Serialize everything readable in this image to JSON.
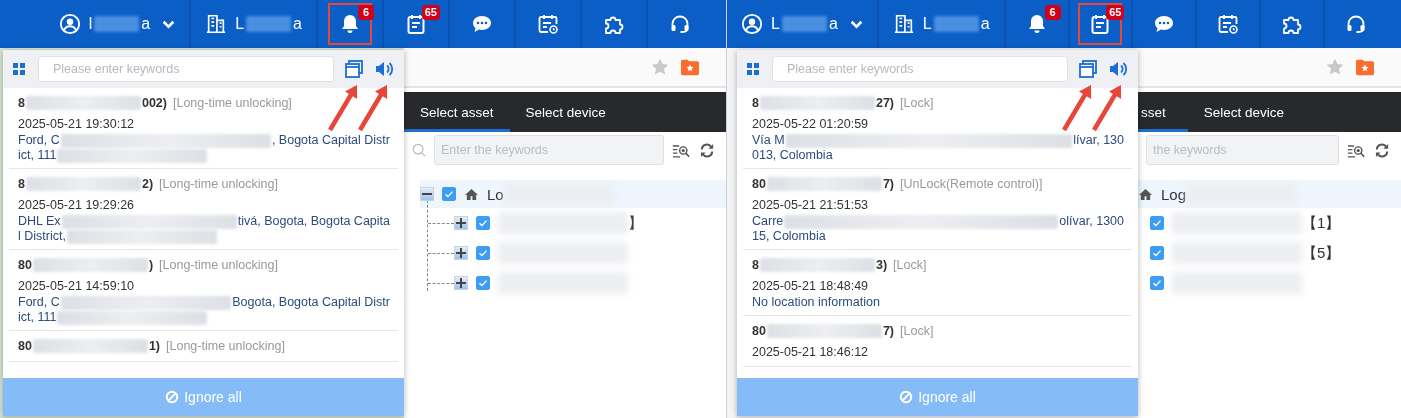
{
  "panels": [
    {
      "topbar": {
        "user": {
          "name_start": "l",
          "name_end": "a"
        },
        "org": {
          "name_start": "L",
          "name_end": "a"
        },
        "icons": [
          {
            "kind": "bell",
            "badge": "6",
            "highlighted": true
          },
          {
            "kind": "notes",
            "badge": "65",
            "highlighted": false
          },
          {
            "kind": "chat",
            "highlighted": false
          },
          {
            "kind": "calendar",
            "highlighted": false
          },
          {
            "kind": "plugin",
            "highlighted": false
          },
          {
            "kind": "headset",
            "highlighted": false
          }
        ]
      },
      "popup": {
        "search": {
          "placeholder": "Please enter keywords"
        },
        "items": [
          {
            "id_start": "8",
            "id_end": "002)",
            "tag": "[Long-time unlocking]",
            "time": "2025-05-21 19:30:12",
            "address": [
              [
                {
                  "kind": "text",
                  "text": "Ford, C"
                },
                {
                  "kind": "blur"
                },
                {
                  "kind": "text",
                  "text": ", Bogota Capital Distr"
                }
              ],
              [
                {
                  "kind": "text",
                  "text": "ict, 111"
                },
                {
                  "kind": "blur"
                }
              ]
            ]
          },
          {
            "id_start": "8",
            "id_end": "2)",
            "tag": "[Long-time unlocking]",
            "time": "2025-05-21 19:29:26",
            "address": [
              [
                {
                  "kind": "text",
                  "text": "DHL Ex"
                },
                {
                  "kind": "blur"
                },
                {
                  "kind": "text",
                  "text": "tivá, Bogota, Bogota Capita"
                }
              ],
              [
                {
                  "kind": "text",
                  "text": "l District,"
                },
                {
                  "kind": "blur"
                }
              ]
            ]
          },
          {
            "id_start": "80",
            "id_end": ")",
            "tag": "[Long-time unlocking]",
            "time": "2025-05-21 14:59:10",
            "address": [
              [
                {
                  "kind": "text",
                  "text": "Ford, C"
                },
                {
                  "kind": "blur"
                },
                {
                  "kind": "text",
                  "text": "Bogota, Bogota Capital Distr"
                }
              ],
              [
                {
                  "kind": "text",
                  "text": "ict, 111"
                },
                {
                  "kind": "blur"
                }
              ]
            ]
          },
          {
            "id_start": "80",
            "id_end": "1)",
            "tag": "[Long-time unlocking]"
          }
        ],
        "button": "Ignore all"
      },
      "page": {
        "tabs": [
          {
            "label": "Select asset",
            "selected": true
          },
          {
            "label": "Select device",
            "selected": false
          }
        ],
        "search": {
          "placeholder": "Enter the keywords",
          "search_icon": true
        },
        "tree": {
          "label_start": "Lo",
          "expanded": true,
          "checked": true,
          "selected": true,
          "children": [
            {
              "checked": true,
              "expanded": false,
              "selected": false,
              "label_end": "】"
            },
            {
              "checked": true,
              "expanded": false,
              "selected": false
            },
            {
              "checked": true,
              "expanded": false,
              "selected": false
            }
          ]
        }
      }
    },
    {
      "topbar": {
        "user": {
          "name_start": "L",
          "name_end": "a"
        },
        "org": {
          "name_start": "L",
          "name_end": "a"
        },
        "icons": [
          {
            "kind": "bell",
            "badge": "6",
            "highlighted": false
          },
          {
            "kind": "notes",
            "badge": "65",
            "highlighted": true
          },
          {
            "kind": "chat",
            "highlighted": false
          },
          {
            "kind": "calendar",
            "highlighted": false
          },
          {
            "kind": "plugin",
            "highlighted": false
          },
          {
            "kind": "headset",
            "highlighted": false
          }
        ]
      },
      "popup": {
        "search": {
          "placeholder": "Please enter keywords"
        },
        "items": [
          {
            "id_start": "8",
            "id_end": "27)",
            "tag": "[Lock]",
            "time": "2025-05-22 01:20:59",
            "address": [
              [
                {
                  "kind": "text",
                  "text": "Vía M"
                },
                {
                  "kind": "blur"
                },
                {
                  "kind": "text",
                  "text": "lívar, 130"
                }
              ],
              [
                {
                  "kind": "text",
                  "text": "013, Colombia"
                }
              ]
            ]
          },
          {
            "id_start": "80",
            "id_end": "7)",
            "tag": "[UnLock(Remote control)]",
            "time": "2025-05-21 21:51:53",
            "address": [
              [
                {
                  "kind": "text",
                  "text": "Carre"
                },
                {
                  "kind": "blur"
                },
                {
                  "kind": "text",
                  "text": "olívar, 1300"
                }
              ],
              [
                {
                  "kind": "text",
                  "text": "15, Colombia"
                }
              ]
            ]
          },
          {
            "id_start": "8",
            "id_end": "3)",
            "tag": "[Lock]",
            "time": "2025-05-21 18:48:49",
            "address": [
              [
                {
                  "kind": "text",
                  "text": "No location information"
                }
              ]
            ]
          },
          {
            "id_start": "80",
            "id_end": "7)",
            "tag": "[Lock]",
            "time": "2025-05-21 18:46:12"
          }
        ],
        "button": "Ignore all"
      },
      "page": {
        "tabs": [
          {
            "label": "sset",
            "selected": true
          },
          {
            "label": "Select device",
            "selected": false
          }
        ],
        "search": {
          "placeholder": "the keywords"
        },
        "tree": {
          "label_start": "Log",
          "selected": true,
          "children": [
            {
              "checked": true,
              "selected": false,
              "label_end": "【1】"
            },
            {
              "checked": true,
              "selected": false,
              "label_end": "【5】"
            },
            {
              "checked": true,
              "selected": false
            }
          ]
        }
      }
    }
  ]
}
